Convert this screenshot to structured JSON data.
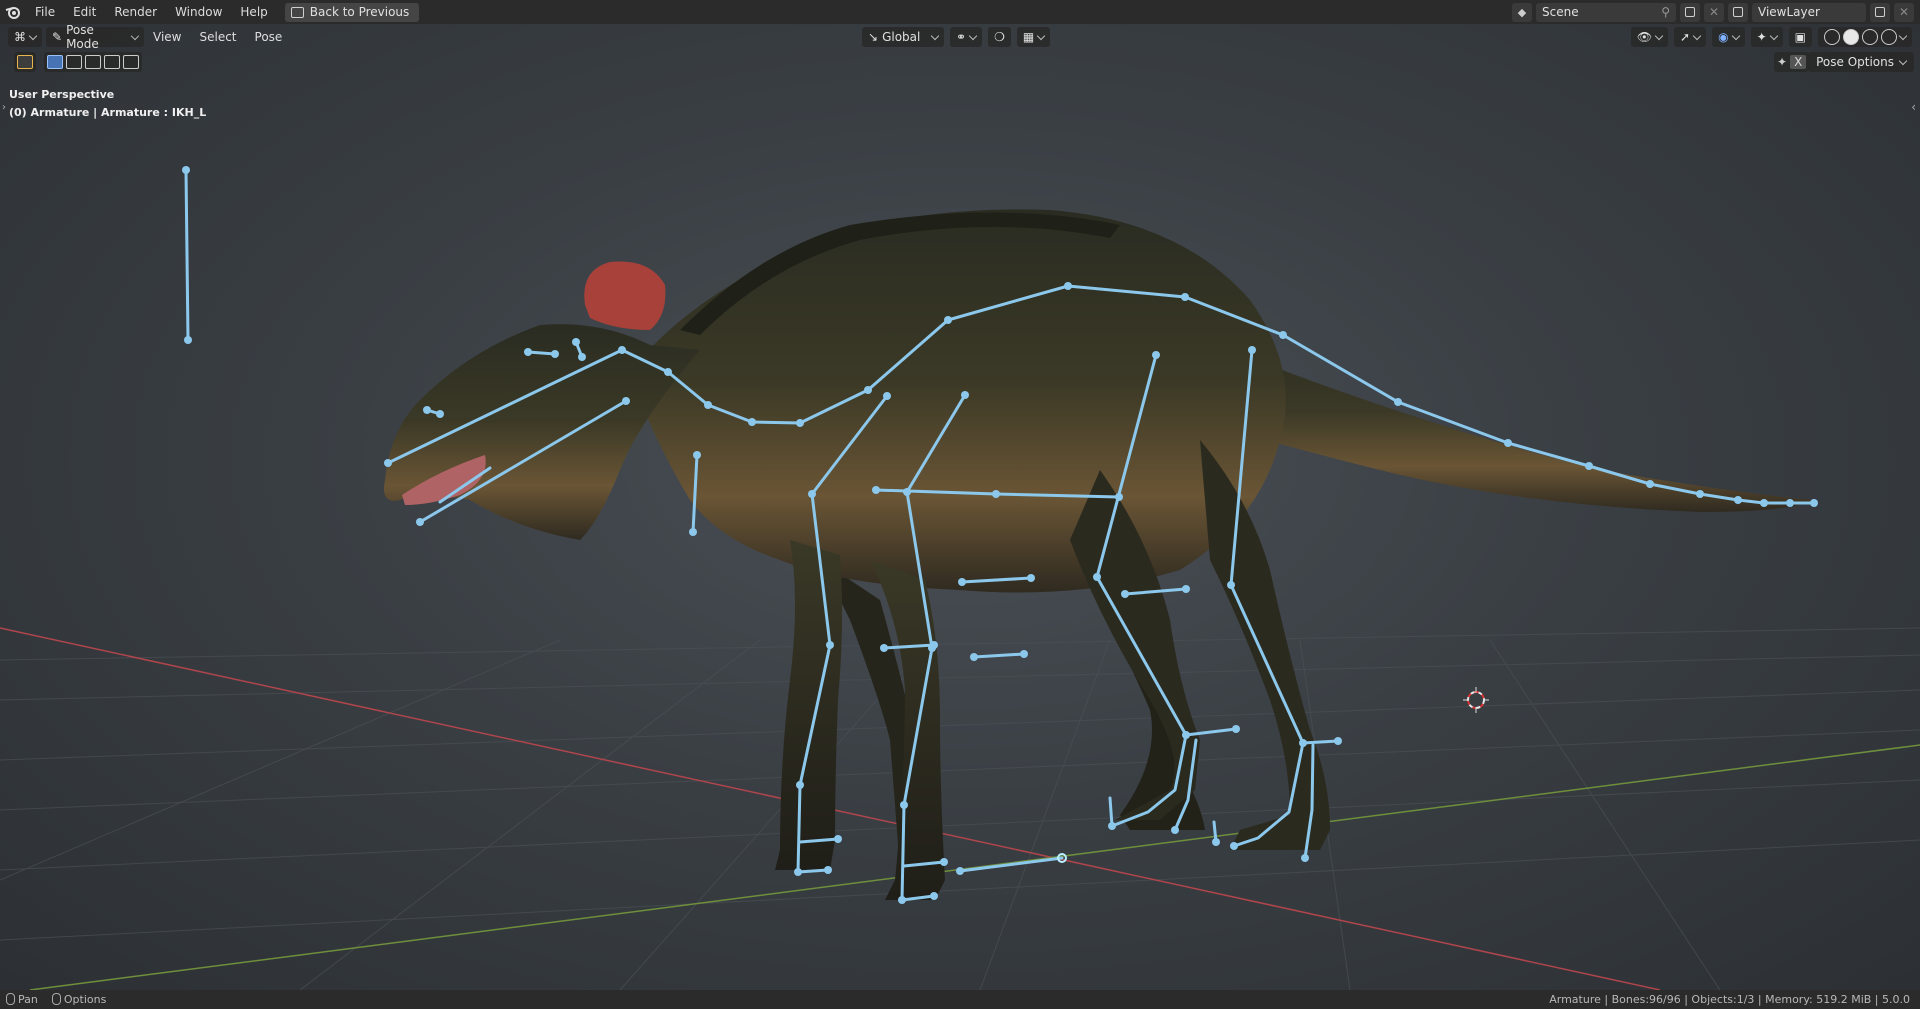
{
  "topbar": {
    "menus": [
      "File",
      "Edit",
      "Render",
      "Window",
      "Help"
    ],
    "back_button": "Back to Previous",
    "scene_name": "Scene",
    "view_layer": "ViewLayer"
  },
  "viewport_header": {
    "mode": "Pose Mode",
    "menus": [
      "View",
      "Select",
      "Pose"
    ],
    "transform_orientation": "Global",
    "pose_options": "Pose Options",
    "x_mirror": "X"
  },
  "overlay": {
    "perspective": "User Perspective",
    "active_object": "(0) Armature | Armature : IKH_L"
  },
  "statusbar": {
    "left": [
      "Pan",
      "Options"
    ],
    "right": "Armature | Bones:96/96 | Objects:1/3 | Memory: 519.2 MiB | 5.0.0"
  },
  "colors": {
    "bone": "#8cc8ec",
    "bone_highlight": "#b8f0ff",
    "x_axis": "#b0454c",
    "y_axis": "#6e8f3c"
  }
}
